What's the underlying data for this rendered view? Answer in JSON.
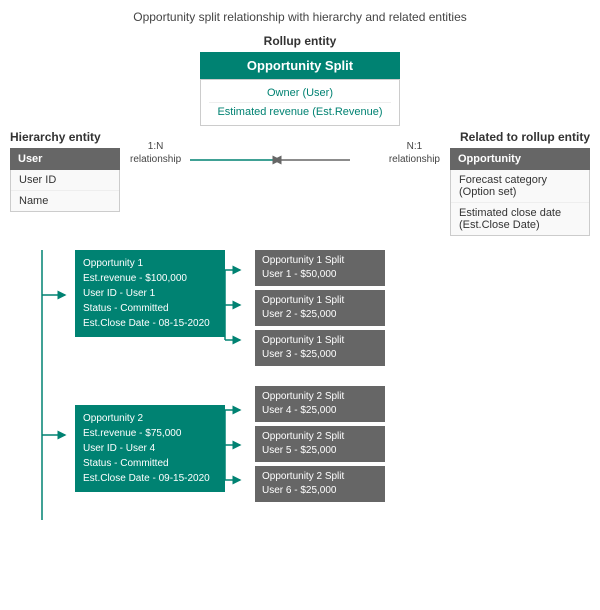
{
  "page": {
    "title": "Opportunity split relationship with hierarchy and related entities"
  },
  "rollup": {
    "label": "Rollup entity",
    "name": "Opportunity Split",
    "fields": [
      "Owner (User)",
      "Estimated revenue (Est.Revenue)"
    ]
  },
  "hierarchy": {
    "label": "Hierarchy entity",
    "name": "User",
    "fields": [
      "User ID",
      "Name"
    ],
    "relationship": "1:N\nrelationship"
  },
  "related": {
    "label": "Related to rollup entity",
    "name": "Opportunity",
    "fields": [
      "Forecast category (Option set)",
      "Estimated close date (Est.Close Date)"
    ],
    "relationship": "N:1\nrelationship"
  },
  "opportunities": [
    {
      "lines": [
        "Opportunity 1",
        "Est.revenue - $100,000",
        "User ID - User 1",
        "Status - Committed",
        "Est.Close Date - 08-15-2020"
      ],
      "splits": [
        "Opportunity 1 Split\nUser 1 - $50,000",
        "Opportunity 1 Split\nUser 2 - $25,000",
        "Opportunity 1 Split\nUser 3 - $25,000"
      ]
    },
    {
      "lines": [
        "Opportunity 2",
        "Est.revenue - $75,000",
        "User ID - User 4",
        "Status - Committed",
        "Est.Close Date - 09-15-2020"
      ],
      "splits": [
        "Opportunity 2 Split\nUser 4 - $25,000",
        "Opportunity 2 Split\nUser 5 - $25,000",
        "Opportunity 2 Split\nUser 6 - $25,000"
      ]
    }
  ]
}
